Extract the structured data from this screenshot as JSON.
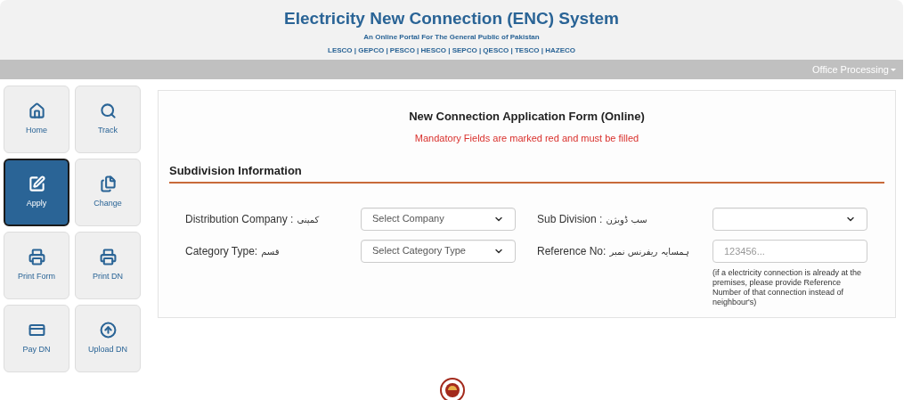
{
  "header": {
    "title": "Electricity New Connection (ENC) System",
    "subtitle": "An Online Portal For The General Public of Pakistan",
    "companies": "LESCO | GEPCO | PESCO | HESCO | SEPCO | QESCO | TESCO | HAZECO"
  },
  "menu_bar": {
    "label": "Office Processing"
  },
  "nav": [
    {
      "label": "Home",
      "kind": "home",
      "selected": false
    },
    {
      "label": "Track",
      "kind": "search",
      "selected": false
    },
    {
      "label": "Apply",
      "kind": "edit",
      "selected": true
    },
    {
      "label": "Change",
      "kind": "files",
      "selected": false
    },
    {
      "label": "Print Form",
      "kind": "printer",
      "selected": false
    },
    {
      "label": "Print DN",
      "kind": "printer",
      "selected": false
    },
    {
      "label": "Pay DN",
      "kind": "card",
      "selected": false
    },
    {
      "label": "Upload DN",
      "kind": "upload",
      "selected": false
    }
  ],
  "form": {
    "title": "New Connection Application Form (Online)",
    "notice": "Mandatory Fields are marked red and must be filled",
    "section": "Subdivision Information",
    "fields": [
      {
        "label": "Distribution Company :",
        "label_urdu": "کمپنی",
        "kind": "select",
        "value": "Select Company"
      },
      {
        "label": "Sub Division :",
        "label_urdu": "سب ڈویژن",
        "kind": "select"
      },
      {
        "label": "Category Type:",
        "label_urdu": "قسم",
        "kind": "select",
        "value": "Select Category Type"
      },
      {
        "label": "Reference No:",
        "label_urdu": "ہمسایہ ریفرنس نمبر",
        "kind": "input",
        "placeholder": "123456...",
        "help": "(if a electricity connection is already at the premises, please provide Reference Number of that connection instead of neighbour's)"
      }
    ]
  }
}
